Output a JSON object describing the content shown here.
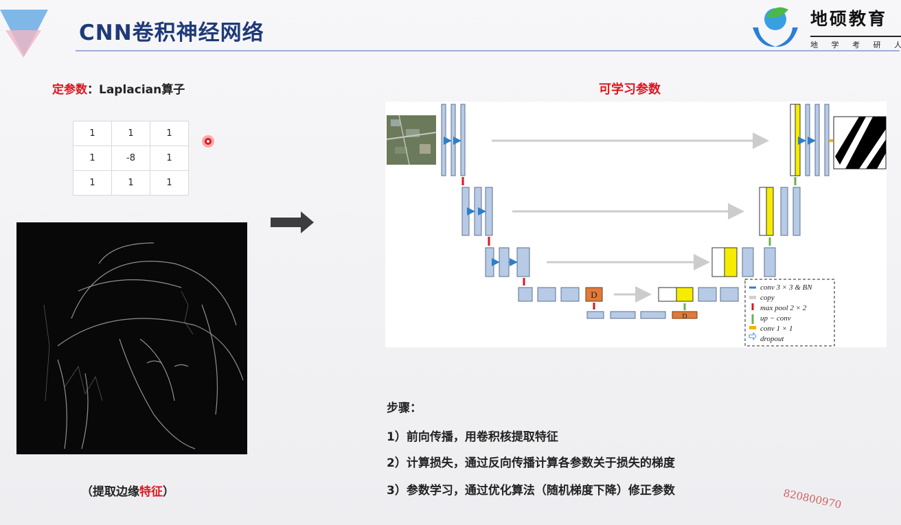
{
  "slide": {
    "title": "CNN卷积神经网络",
    "accent_color": "#e0141c",
    "title_color": "#1f3a78"
  },
  "logo": {
    "icon": "hands-globe-icon",
    "name": "地硕教育",
    "tagline": "地 学 考 研 人 的"
  },
  "left": {
    "label_prefix": "定参数",
    "label_suffix": "：Laplacian算子",
    "kernel": [
      [
        "1",
        "1",
        "1"
      ],
      [
        "1",
        "-8",
        "1"
      ],
      [
        "1",
        "1",
        "1"
      ]
    ],
    "caption_open": "（提取边缘",
    "caption_highlight": "特征",
    "caption_close": "）"
  },
  "right": {
    "label": "可学习参数",
    "block_letter": "D",
    "legend": [
      {
        "text": "conv 3 × 3 & BN",
        "color": "#2f7fc4"
      },
      {
        "text": "copy",
        "color": "#d0d0d0"
      },
      {
        "text": "max pool 2 × 2",
        "color": "#e0141c"
      },
      {
        "text": "up − conv",
        "color": "#6ab04c"
      },
      {
        "text": "conv 1 × 1",
        "color": "#f0b400"
      },
      {
        "text": "dropout",
        "color": "#4a90e2"
      }
    ]
  },
  "steps": {
    "title": "步骤：",
    "items": [
      "1）前向传播，用卷积核提取特征",
      "2）计算损失，通过反向传播计算各参数关于损失的梯度",
      "3）参数学习，通过优化算法（随机梯度下降）修正参数"
    ]
  },
  "watermark": "820800970"
}
